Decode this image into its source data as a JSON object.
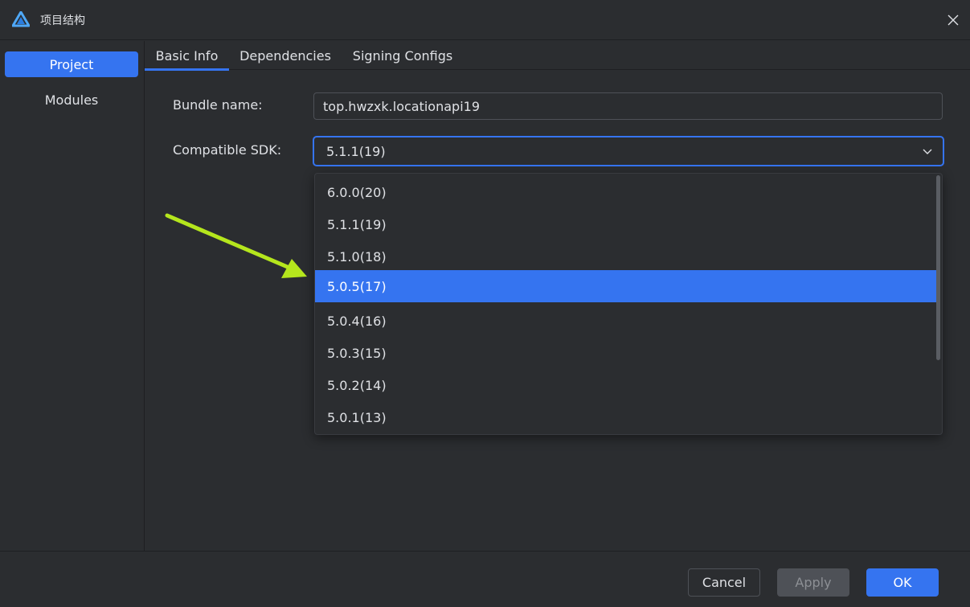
{
  "window": {
    "title": "项目结构",
    "close_icon": "close-icon",
    "logo_icon": "app-logo-icon"
  },
  "sidebar": {
    "items": [
      {
        "label": "Project",
        "active": true
      },
      {
        "label": "Modules",
        "active": false
      }
    ]
  },
  "tabs": [
    {
      "label": "Basic Info",
      "active": true
    },
    {
      "label": "Dependencies",
      "active": false
    },
    {
      "label": "Signing Configs",
      "active": false
    }
  ],
  "form": {
    "bundle_name_label": "Bundle name:",
    "bundle_name_value": "top.hwzxk.locationapi19",
    "sdk_label": "Compatible SDK:",
    "sdk_value": "5.1.1(19)"
  },
  "dropdown": {
    "options": [
      "6.0.0(20)",
      "5.1.1(19)",
      "5.1.0(18)",
      "5.0.5(17)",
      "5.0.4(16)",
      "5.0.3(15)",
      "5.0.2(14)",
      "5.0.1(13)"
    ],
    "highlighted": "5.0.5(17)"
  },
  "footer": {
    "cancel_label": "Cancel",
    "apply_label": "Apply",
    "ok_label": "OK"
  },
  "colors": {
    "accent": "#3574f0",
    "background": "#2b2d30",
    "annotation_arrow": "#b5e61d"
  }
}
